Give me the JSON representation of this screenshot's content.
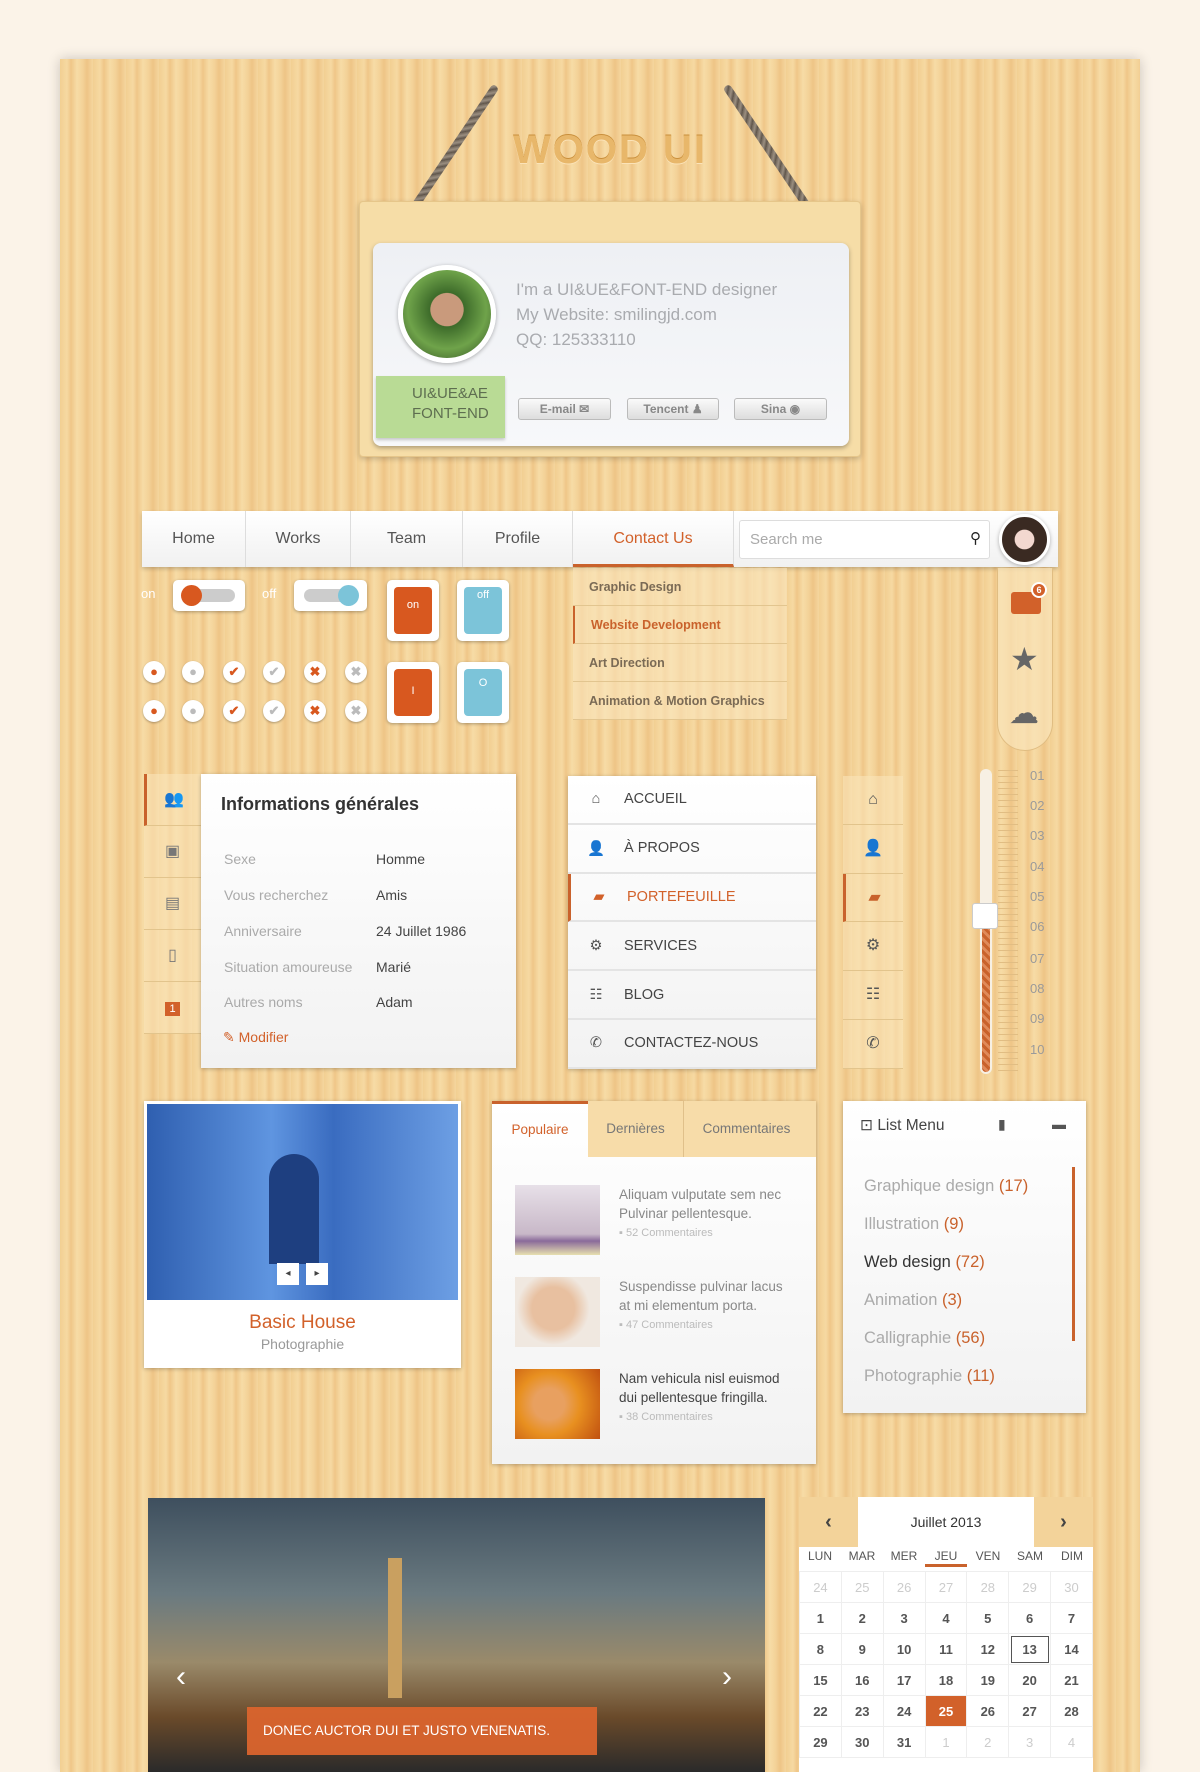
{
  "title": "WOOD UI",
  "profile": {
    "line1": "I'm a UI&UE&FONT-END designer",
    "line2": "My Website: smilingjd.com",
    "line3": "QQ: 125333110",
    "tag_line1": "UI&UE&AE",
    "tag_line2": "FONT-END",
    "buttons": [
      {
        "label": "E-mail",
        "icon": "mail-icon"
      },
      {
        "label": "Tencent",
        "icon": "qq-icon"
      },
      {
        "label": "Sina",
        "icon": "weibo-icon"
      }
    ]
  },
  "nav": {
    "tabs": [
      "Home",
      "Works",
      "Team",
      "Profile",
      "Contact Us"
    ],
    "active": "Contact Us",
    "search_placeholder": "Search me",
    "dropdown": [
      "Graphic Design",
      "Website Development",
      "Art Direction",
      "Animation & Motion Graphics"
    ],
    "dropdown_active": "Website Development"
  },
  "toolbar": {
    "badge": "6",
    "icons": [
      "inbox-icon",
      "star-icon",
      "cloud-icon"
    ]
  },
  "controls": {
    "on_label": "on",
    "off_label": "off",
    "switch_on": "on",
    "switch_off": "off",
    "switch_i": "I",
    "switch_o": "O"
  },
  "info": {
    "title": "Informations générales",
    "rows": [
      {
        "label": "Sexe",
        "value": "Homme"
      },
      {
        "label": "Vous recherchez",
        "value": "Amis"
      },
      {
        "label": "Anniversaire",
        "value": "24 Juillet 1986"
      },
      {
        "label": "Situation amoureuse",
        "value": "Marié"
      },
      {
        "label": "Autres noms",
        "value": "Adam"
      }
    ],
    "edit": "Modifier",
    "side_badge": "1"
  },
  "menu": {
    "items": [
      {
        "label": "ACCUEIL",
        "icon": "home-icon"
      },
      {
        "label": "À PROPOS",
        "icon": "users-icon"
      },
      {
        "label": "PORTEFEUILLE",
        "icon": "briefcase-icon"
      },
      {
        "label": "SERVICES",
        "icon": "gear-icon"
      },
      {
        "label": "BLOG",
        "icon": "list-icon"
      },
      {
        "label": "CONTACTEZ-NOUS",
        "icon": "phone-icon"
      }
    ],
    "active": "PORTEFEUILLE"
  },
  "slider": {
    "labels": [
      "01",
      "02",
      "03",
      "04",
      "05",
      "06",
      "07",
      "08",
      "09",
      "10"
    ],
    "value": "06"
  },
  "photo_card": {
    "title": "Basic House",
    "subtitle": "Photographie"
  },
  "tabs_panel": {
    "tabs": [
      "Populaire",
      "Dernières",
      "Commentaires"
    ],
    "active": "Populaire",
    "posts": [
      {
        "text1": "Aliquam vulputate sem nec",
        "text2": "Pulvinar pellentesque.",
        "comments": "52 Commentaires"
      },
      {
        "text1": "Suspendisse pulvinar lacus",
        "text2": "at mi elementum porta.",
        "comments": "47 Commentaires"
      },
      {
        "text1": "Nam vehicula nisl euismod",
        "text2": "dui pellentesque fringilla.",
        "comments": "38 Commentaires"
      }
    ]
  },
  "list_menu": {
    "title": "List Menu",
    "items": [
      {
        "label": "Graphique design",
        "count": "(17)"
      },
      {
        "label": "Illustration",
        "count": "(9)"
      },
      {
        "label": "Web design",
        "count": "(72)"
      },
      {
        "label": "Animation",
        "count": "(3)"
      },
      {
        "label": "Calligraphie",
        "count": "(56)"
      },
      {
        "label": "Photographie",
        "count": "(11)"
      }
    ],
    "active": "Web design"
  },
  "slideshow": {
    "caption": "DONEC AUCTOR DUI ET JUSTO VENENATIS."
  },
  "calendar": {
    "month": "Juillet 2013",
    "days": [
      "LUN",
      "MAR",
      "MER",
      "JEU",
      "VEN",
      "SAM",
      "DIM"
    ],
    "weeks": [
      [
        "24",
        "25",
        "26",
        "27",
        "28",
        "29",
        "30"
      ],
      [
        "1",
        "2",
        "3",
        "4",
        "5",
        "6",
        "7"
      ],
      [
        "8",
        "9",
        "10",
        "11",
        "12",
        "13",
        "14"
      ],
      [
        "15",
        "16",
        "17",
        "18",
        "19",
        "20",
        "21"
      ],
      [
        "22",
        "23",
        "24",
        "25",
        "26",
        "27",
        "28"
      ],
      [
        "29",
        "30",
        "31",
        "1",
        "2",
        "3",
        "4"
      ]
    ],
    "selected": "25",
    "today": "13"
  },
  "colors": {
    "accent": "#d2612a",
    "blue": "#7cc4d9",
    "tag_green": "#b9db95"
  }
}
